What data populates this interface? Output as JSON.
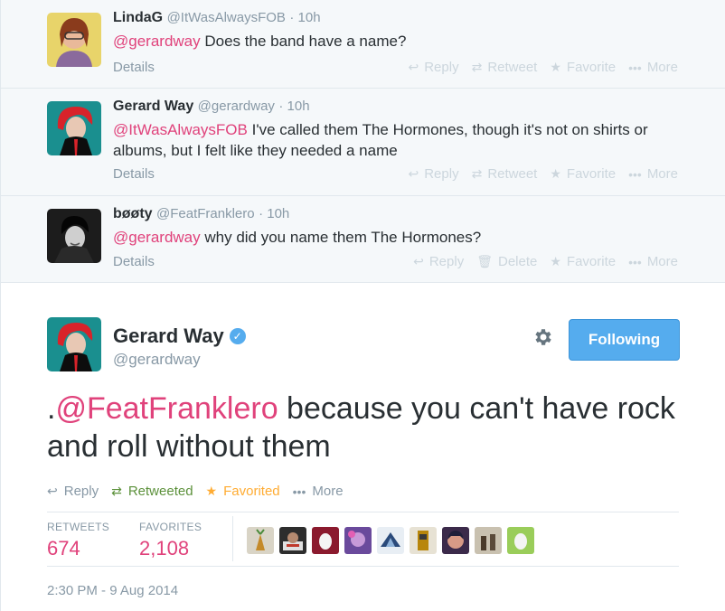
{
  "conversation": [
    {
      "name": "LindaG",
      "handle": "@ItWasAlwaysFOB",
      "time": "· 10h",
      "mention": "@gerardway",
      "text": " Does the band have a name?",
      "details": "Details",
      "actions": [
        "Reply",
        "Retweet",
        "Favorite",
        "More"
      ]
    },
    {
      "name": "Gerard Way",
      "handle": "@gerardway",
      "time": "· 10h",
      "mention": "@ItWasAlwaysFOB",
      "text": " I've called them The Hormones, though it's not on shirts or albums, but I felt like they needed a name",
      "details": "Details",
      "actions": [
        "Reply",
        "Retweet",
        "Favorite",
        "More"
      ]
    },
    {
      "name": "bøøty",
      "handle": "@FeatFranklero",
      "time": "· 10h",
      "mention": "@gerardway",
      "text": " why did you name them The Hormones?",
      "details": "Details",
      "actions": [
        "Reply",
        "Delete",
        "Favorite",
        "More"
      ]
    }
  ],
  "main_tweet": {
    "name": "Gerard Way",
    "handle": "@gerardway",
    "follow_label": "Following",
    "text_prefix": ".",
    "mention": "@FeatFranklero",
    "text": " because you can't have rock and roll without them",
    "actions": {
      "reply": "Reply",
      "retweeted": "Retweeted",
      "favorited": "Favorited",
      "more": "More"
    },
    "retweets_label": "RETWEETS",
    "retweets_value": "674",
    "favorites_label": "FAVORITES",
    "favorites_value": "2,108",
    "timestamp": "2:30 PM - 9 Aug 2014"
  },
  "colors": {
    "accent": "#55acee",
    "mention": "#e0427b",
    "muted": "#8899a6",
    "retweeted": "#5c913b",
    "favorited": "#ffac33"
  }
}
